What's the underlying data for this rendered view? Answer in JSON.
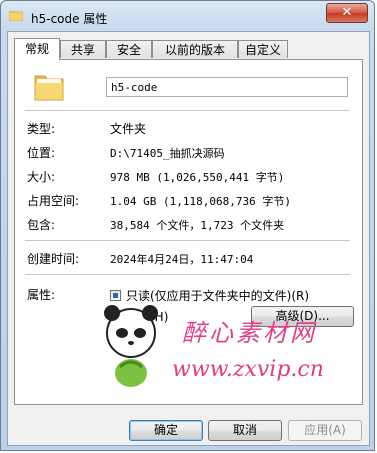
{
  "window": {
    "title": "h5-code 属性",
    "close_label": "✕"
  },
  "tabs": [
    {
      "label": "常规"
    },
    {
      "label": "共享"
    },
    {
      "label": "安全"
    },
    {
      "label": "以前的版本"
    },
    {
      "label": "自定义"
    }
  ],
  "general": {
    "folder_name": "h5-code",
    "type_label": "类型:",
    "type_value": "文件夹",
    "location_label": "位置:",
    "location_value": "D:\\71405_抽抓决源码",
    "size_label": "大小:",
    "size_value": "978 MB (1,026,550,441 字节)",
    "disk_size_label": "占用空间:",
    "disk_size_value": "1.04 GB (1,118,068,736 字节)",
    "contains_label": "包含:",
    "contains_value": "38,584 个文件，1,723 个文件夹",
    "created_label": "创建时间:",
    "created_value": "2024年4月24日，11:47:04",
    "attributes_label": "属性:",
    "readonly_label": "只读(仅应用于文件夹中的文件)(R)",
    "readonly_checked": true,
    "hidden_label": "隐藏(H)",
    "hidden_checked": false,
    "advanced_button": "高级(D)..."
  },
  "watermark": {
    "line1": "醉心素材网",
    "line2": "www.zxvip.cn"
  },
  "footer": {
    "ok": "确定",
    "cancel": "取消",
    "apply": "应用(A)"
  },
  "colors": {
    "accent": "#3c7fb1",
    "watermark": "#e0408a"
  }
}
